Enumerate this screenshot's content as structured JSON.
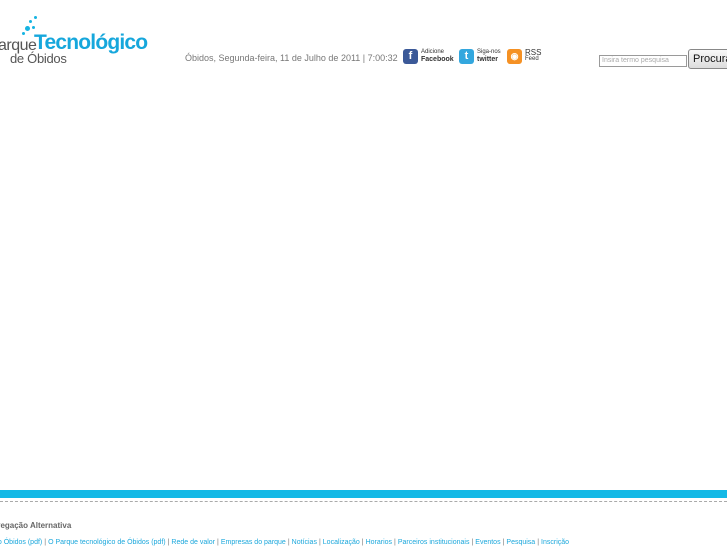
{
  "logo": {
    "prefix": "arque",
    "main": "Tecnológico",
    "sub": "de Óbidos"
  },
  "header": {
    "datetime": "Óbidos, Segunda-feira, 11 de Julho de 2011 | 7:00:32"
  },
  "social": {
    "facebook": {
      "line1": "Adicione",
      "line2": "Facebook",
      "icon": "facebook-icon"
    },
    "twitter": {
      "line1": "Siga-nos",
      "line2": "twitter",
      "icon": "twitter-icon"
    },
    "rss": {
      "line1": "RSS",
      "line2": "Feed",
      "icon": "rss-icon"
    }
  },
  "search": {
    "placeholder": "Insira termo pesquisa",
    "button_label": "Procura"
  },
  "footer": {
    "alt_nav_title": "vegação Alternativa",
    "links": [
      "do Óbidos (pdf)",
      "O Parque tecnológico de Óbidos (pdf)",
      "Rede de valor",
      "Empresas do parque",
      "Notícias",
      "Localização",
      "Horarios",
      "Parceiros institucionais",
      "Eventos",
      "Pesquisa",
      "Inscrição"
    ]
  },
  "colors": {
    "accent": "#14b9e6",
    "link": "#1aa7dc"
  }
}
